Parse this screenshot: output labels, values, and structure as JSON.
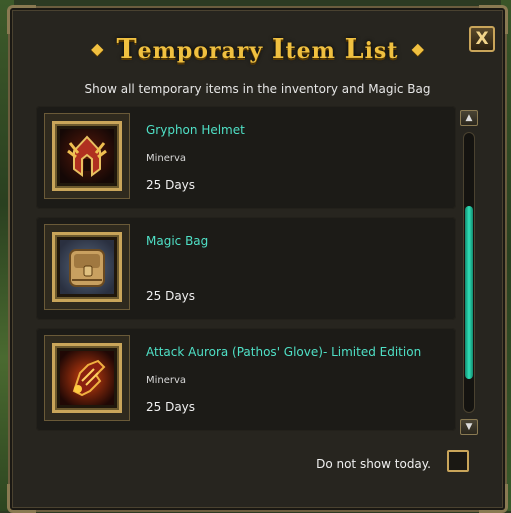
{
  "dialog": {
    "title": "Temporary Item List",
    "title_first": [
      "T",
      "emporary "
    ],
    "title_second": [
      "I",
      "tem "
    ],
    "title_third": [
      "L",
      "ist"
    ],
    "subtitle": "Show all temporary items in the inventory and Magic Bag",
    "close_label": "X"
  },
  "items": [
    {
      "name": "Gryphon Helmet",
      "owner": "Minerva",
      "duration": "25 Days",
      "icon": "gryphon-helmet-icon"
    },
    {
      "name": "Magic Bag",
      "owner": "",
      "duration": "25 Days",
      "icon": "magic-bag-icon"
    },
    {
      "name": "Attack Aurora (Pathos' Glove)- Limited Edition",
      "owner": "Minerva",
      "duration": "25 Days",
      "icon": "glove-icon"
    }
  ],
  "scroll": {
    "position": 0.0,
    "visible_fraction": 0.62
  },
  "footer": {
    "do_not_show_label": "Do not show today.",
    "do_not_show_checked": false
  },
  "colors": {
    "title": "#f0c040",
    "item_name": "#4fe0c6",
    "scroll_thumb": "#2fe0b8"
  }
}
